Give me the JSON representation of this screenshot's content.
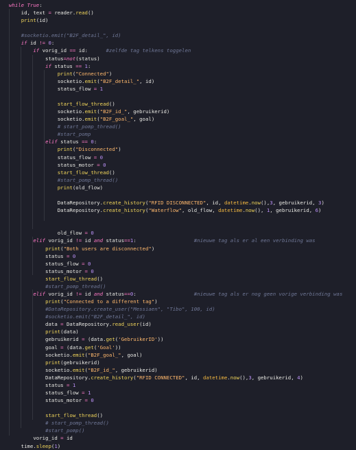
{
  "editor": {
    "language": "python",
    "theme_background": "#1e1f29",
    "lines": [
      [
        {
          "t": "while",
          "c": "t-kwi"
        },
        {
          "t": " "
        },
        {
          "t": "True",
          "c": "t-kwi"
        },
        {
          "t": ":"
        }
      ],
      [
        {
          "t": "    id, text "
        },
        {
          "t": "=",
          "c": "t-op"
        },
        {
          "t": " reader.",
          "c": "t-id"
        },
        {
          "t": "read",
          "c": "t-fn"
        },
        {
          "t": "()"
        }
      ],
      [
        {
          "t": "    "
        },
        {
          "t": "print",
          "c": "t-fn"
        },
        {
          "t": "(id)"
        }
      ],
      [
        {
          "t": ""
        }
      ],
      [
        {
          "t": "    "
        },
        {
          "t": "#socketio.emit(\"B2F_detail_\", id)",
          "c": "t-cm"
        }
      ],
      [
        {
          "t": "    "
        },
        {
          "t": "if",
          "c": "t-kwi"
        },
        {
          "t": " id "
        },
        {
          "t": "!=",
          "c": "t-op"
        },
        {
          "t": " "
        },
        {
          "t": "0",
          "c": "t-num"
        },
        {
          "t": ":"
        }
      ],
      [
        {
          "t": "        "
        },
        {
          "t": "if",
          "c": "t-kwi"
        },
        {
          "t": " vorig_id "
        },
        {
          "t": "==",
          "c": "t-op"
        },
        {
          "t": " id:      "
        },
        {
          "t": "#zelfde tag telkens toggelen",
          "c": "t-cm"
        }
      ],
      [
        {
          "t": "            status"
        },
        {
          "t": "=",
          "c": "t-op"
        },
        {
          "t": "not",
          "c": "t-kwi"
        },
        {
          "t": "(status)"
        }
      ],
      [
        {
          "t": "            "
        },
        {
          "t": "if",
          "c": "t-kwi"
        },
        {
          "t": " status "
        },
        {
          "t": "==",
          "c": "t-op"
        },
        {
          "t": " "
        },
        {
          "t": "1",
          "c": "t-num"
        },
        {
          "t": ":"
        }
      ],
      [
        {
          "t": "                "
        },
        {
          "t": "print",
          "c": "t-fn"
        },
        {
          "t": "("
        },
        {
          "t": "\"Connected\"",
          "c": "t-str"
        },
        {
          "t": ")"
        }
      ],
      [
        {
          "t": "                socketio."
        },
        {
          "t": "emit",
          "c": "t-fn"
        },
        {
          "t": "("
        },
        {
          "t": "\"B2F_detail_\"",
          "c": "t-str"
        },
        {
          "t": ", id)"
        }
      ],
      [
        {
          "t": "                status_flow "
        },
        {
          "t": "=",
          "c": "t-op"
        },
        {
          "t": " "
        },
        {
          "t": "1",
          "c": "t-num"
        }
      ],
      [
        {
          "t": ""
        }
      ],
      [
        {
          "t": "                "
        },
        {
          "t": "start_flow_thread",
          "c": "t-fn"
        },
        {
          "t": "()"
        }
      ],
      [
        {
          "t": "                socketio."
        },
        {
          "t": "emit",
          "c": "t-fn"
        },
        {
          "t": "("
        },
        {
          "t": "\"B2F_id_\"",
          "c": "t-str"
        },
        {
          "t": ", gebruikerid)"
        }
      ],
      [
        {
          "t": "                socketio."
        },
        {
          "t": "emit",
          "c": "t-fn"
        },
        {
          "t": "("
        },
        {
          "t": "\"B2F_goal_\"",
          "c": "t-str"
        },
        {
          "t": ", goal)"
        }
      ],
      [
        {
          "t": "                "
        },
        {
          "t": "# start_pomp_thread()",
          "c": "t-cm"
        }
      ],
      [
        {
          "t": "                "
        },
        {
          "t": "#start_pomp",
          "c": "t-cm"
        }
      ],
      [
        {
          "t": "            "
        },
        {
          "t": "elif",
          "c": "t-kwi"
        },
        {
          "t": " status "
        },
        {
          "t": "==",
          "c": "t-op"
        },
        {
          "t": " "
        },
        {
          "t": "0",
          "c": "t-num"
        },
        {
          "t": ":"
        }
      ],
      [
        {
          "t": "                "
        },
        {
          "t": "print",
          "c": "t-fn"
        },
        {
          "t": "("
        },
        {
          "t": "\"Disconnected\"",
          "c": "t-str"
        },
        {
          "t": ")"
        }
      ],
      [
        {
          "t": "                status_flow "
        },
        {
          "t": "=",
          "c": "t-op"
        },
        {
          "t": " "
        },
        {
          "t": "0",
          "c": "t-num"
        }
      ],
      [
        {
          "t": "                status_motor "
        },
        {
          "t": "=",
          "c": "t-op"
        },
        {
          "t": " "
        },
        {
          "t": "0",
          "c": "t-num"
        }
      ],
      [
        {
          "t": "                "
        },
        {
          "t": "start_flow_thread",
          "c": "t-fn"
        },
        {
          "t": "()"
        }
      ],
      [
        {
          "t": "                "
        },
        {
          "t": "#start_pomp_thread()",
          "c": "t-cm"
        }
      ],
      [
        {
          "t": "                "
        },
        {
          "t": "print",
          "c": "t-fn"
        },
        {
          "t": "(old_flow)"
        }
      ],
      [
        {
          "t": ""
        }
      ],
      [
        {
          "t": "                DataRepository."
        },
        {
          "t": "create_history",
          "c": "t-fn"
        },
        {
          "t": "("
        },
        {
          "t": "\"RFID DISCONNECTED\"",
          "c": "t-str"
        },
        {
          "t": ", id, "
        },
        {
          "t": "datetime",
          "c": "t-fnb"
        },
        {
          "t": "."
        },
        {
          "t": "now",
          "c": "t-fn"
        },
        {
          "t": "(),"
        },
        {
          "t": "3",
          "c": "t-num"
        },
        {
          "t": ", gebruikerid, "
        },
        {
          "t": "3",
          "c": "t-num"
        },
        {
          "t": ")"
        }
      ],
      [
        {
          "t": "                DataRepository."
        },
        {
          "t": "create_history",
          "c": "t-fn"
        },
        {
          "t": "("
        },
        {
          "t": "\"Waterflow\"",
          "c": "t-str"
        },
        {
          "t": ", old_flow, "
        },
        {
          "t": "datetime",
          "c": "t-fnb"
        },
        {
          "t": "."
        },
        {
          "t": "now",
          "c": "t-fn"
        },
        {
          "t": "(), "
        },
        {
          "t": "1",
          "c": "t-num"
        },
        {
          "t": ", gebruikerid, "
        },
        {
          "t": "6",
          "c": "t-num"
        },
        {
          "t": ")"
        }
      ],
      [
        {
          "t": ""
        }
      ],
      [
        {
          "t": ""
        }
      ],
      [
        {
          "t": "                old_flow "
        },
        {
          "t": "=",
          "c": "t-op"
        },
        {
          "t": " "
        },
        {
          "t": "0",
          "c": "t-num"
        }
      ],
      [
        {
          "t": "        "
        },
        {
          "t": "elif",
          "c": "t-kwi"
        },
        {
          "t": " vorig_id "
        },
        {
          "t": "!=",
          "c": "t-op"
        },
        {
          "t": " id "
        },
        {
          "t": "and",
          "c": "t-kwi"
        },
        {
          "t": " status"
        },
        {
          "t": "==",
          "c": "t-op"
        },
        {
          "t": "1",
          "c": "t-num"
        },
        {
          "t": ":                   "
        },
        {
          "t": "#nieuwe tag als er al een verbinding was",
          "c": "t-cm"
        }
      ],
      [
        {
          "t": "            "
        },
        {
          "t": "print",
          "c": "t-fn"
        },
        {
          "t": "("
        },
        {
          "t": "\"Both users are disconnected\"",
          "c": "t-str"
        },
        {
          "t": ")"
        }
      ],
      [
        {
          "t": "            status "
        },
        {
          "t": "=",
          "c": "t-op"
        },
        {
          "t": " "
        },
        {
          "t": "0",
          "c": "t-num"
        }
      ],
      [
        {
          "t": "            status_flow "
        },
        {
          "t": "=",
          "c": "t-op"
        },
        {
          "t": " "
        },
        {
          "t": "0",
          "c": "t-num"
        }
      ],
      [
        {
          "t": "            status_motor "
        },
        {
          "t": "=",
          "c": "t-op"
        },
        {
          "t": " "
        },
        {
          "t": "0",
          "c": "t-num"
        }
      ],
      [
        {
          "t": "            "
        },
        {
          "t": "start_flow_thread",
          "c": "t-fn"
        },
        {
          "t": "()"
        }
      ],
      [
        {
          "t": "            "
        },
        {
          "t": "#start_pomp_thread()",
          "c": "t-cm"
        }
      ],
      [
        {
          "t": "        "
        },
        {
          "t": "elif",
          "c": "t-kwi"
        },
        {
          "t": " vorig_id "
        },
        {
          "t": "!=",
          "c": "t-op"
        },
        {
          "t": " id "
        },
        {
          "t": "and",
          "c": "t-kwi"
        },
        {
          "t": " status"
        },
        {
          "t": "==",
          "c": "t-op"
        },
        {
          "t": "0",
          "c": "t-num"
        },
        {
          "t": ":                   "
        },
        {
          "t": "#nieuwe tag als er nog geen vorige verbinding was",
          "c": "t-cm"
        }
      ],
      [
        {
          "t": "            "
        },
        {
          "t": "print",
          "c": "t-fn"
        },
        {
          "t": "("
        },
        {
          "t": "\"Connected to a different tag\"",
          "c": "t-str"
        },
        {
          "t": ")"
        }
      ],
      [
        {
          "t": "            "
        },
        {
          "t": "#DataRepository.create_user(\"Messiaen\", \"Tibo\", 100, id)",
          "c": "t-cm"
        }
      ],
      [
        {
          "t": "            "
        },
        {
          "t": "#socketio.emit(\"B2F_detail_\", id)",
          "c": "t-cm"
        }
      ],
      [
        {
          "t": "            data "
        },
        {
          "t": "=",
          "c": "t-op"
        },
        {
          "t": " DataRepository."
        },
        {
          "t": "read_user",
          "c": "t-fn"
        },
        {
          "t": "(id)"
        }
      ],
      [
        {
          "t": "            "
        },
        {
          "t": "print",
          "c": "t-fn"
        },
        {
          "t": "(data)"
        }
      ],
      [
        {
          "t": "            gebruikerid "
        },
        {
          "t": "=",
          "c": "t-op"
        },
        {
          "t": " (data."
        },
        {
          "t": "get",
          "c": "t-fn"
        },
        {
          "t": "("
        },
        {
          "t": "'GebruikerID'",
          "c": "t-str"
        },
        {
          "t": "))"
        }
      ],
      [
        {
          "t": "            goal "
        },
        {
          "t": "=",
          "c": "t-op"
        },
        {
          "t": " (data."
        },
        {
          "t": "get",
          "c": "t-fn"
        },
        {
          "t": "("
        },
        {
          "t": "'Goal'",
          "c": "t-str"
        },
        {
          "t": "))"
        }
      ],
      [
        {
          "t": "            socketio."
        },
        {
          "t": "emit",
          "c": "t-fn"
        },
        {
          "t": "("
        },
        {
          "t": "\"B2F_goal_\"",
          "c": "t-str"
        },
        {
          "t": ", goal)"
        }
      ],
      [
        {
          "t": "            "
        },
        {
          "t": "print",
          "c": "t-fn"
        },
        {
          "t": "(gebruikerid)"
        }
      ],
      [
        {
          "t": "            socketio."
        },
        {
          "t": "emit",
          "c": "t-fn"
        },
        {
          "t": "("
        },
        {
          "t": "\"B2F_id_\"",
          "c": "t-str"
        },
        {
          "t": ", gebruikerid)"
        }
      ],
      [
        {
          "t": "            DataRepository."
        },
        {
          "t": "create_history",
          "c": "t-fn"
        },
        {
          "t": "("
        },
        {
          "t": "\"RFID CONNECTED\"",
          "c": "t-str"
        },
        {
          "t": ", id, "
        },
        {
          "t": "datetime",
          "c": "t-fnb"
        },
        {
          "t": "."
        },
        {
          "t": "now",
          "c": "t-fn"
        },
        {
          "t": "(),"
        },
        {
          "t": "3",
          "c": "t-num"
        },
        {
          "t": ", gebruikerid, "
        },
        {
          "t": "4",
          "c": "t-num"
        },
        {
          "t": ")"
        }
      ],
      [
        {
          "t": "            status "
        },
        {
          "t": "=",
          "c": "t-op"
        },
        {
          "t": " "
        },
        {
          "t": "1",
          "c": "t-num"
        }
      ],
      [
        {
          "t": "            status_flow "
        },
        {
          "t": "=",
          "c": "t-op"
        },
        {
          "t": " "
        },
        {
          "t": "1",
          "c": "t-num"
        }
      ],
      [
        {
          "t": "            status_motor "
        },
        {
          "t": "=",
          "c": "t-op"
        },
        {
          "t": " "
        },
        {
          "t": "0",
          "c": "t-num"
        }
      ],
      [
        {
          "t": ""
        }
      ],
      [
        {
          "t": "            "
        },
        {
          "t": "start_flow_thread",
          "c": "t-fn"
        },
        {
          "t": "()"
        }
      ],
      [
        {
          "t": "            "
        },
        {
          "t": "# start_pomp_thread()",
          "c": "t-cm"
        }
      ],
      [
        {
          "t": "            "
        },
        {
          "t": "#start_pomp()",
          "c": "t-cm"
        }
      ],
      [
        {
          "t": "        vorig_id "
        },
        {
          "t": "=",
          "c": "t-op"
        },
        {
          "t": " id"
        }
      ],
      [
        {
          "t": "    time."
        },
        {
          "t": "sleep",
          "c": "t-fn"
        },
        {
          "t": "("
        },
        {
          "t": "1",
          "c": "t-num"
        },
        {
          "t": ")"
        }
      ]
    ]
  }
}
